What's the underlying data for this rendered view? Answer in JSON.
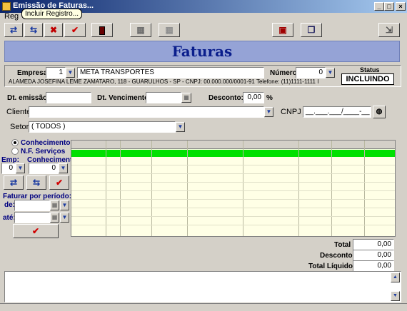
{
  "window": {
    "title": "Emissão de Faturas..."
  },
  "menu": {
    "first": "Reg"
  },
  "tooltip": "Incluir Registro...",
  "toolbar": {
    "add_icon": "add-record-icon",
    "edit_icon": "edit-record-icon",
    "delete_icon": "delete-icon",
    "confirm_icon": "check-icon",
    "calculator_icon": "calculator-icon",
    "print_icon": "printer-icon",
    "preview_icon": "grid-icon",
    "search_icon": "search-doc-icon",
    "copy_icon": "copy-doc-icon",
    "exit_icon": "exit-icon"
  },
  "banner": {
    "title": "Faturas"
  },
  "company": {
    "empresa_label": "Empresa",
    "empresa_value": "1",
    "empresa_name": "META TRANSPORTES",
    "numero_label": "Número",
    "numero_value": "0",
    "status_label": "Status",
    "status_value": "INCLUINDO",
    "address": "ALAMEDA JOSEFINA LEME ZAMATARO, 118 - GUARULHOS - SP - CNPJ: 00.000.000/0001-91 Telefone: (11)1111-1111 I"
  },
  "dates": {
    "emissao_label": "Dt. emissão:",
    "vencimento_label": "Dt. Vencimento:",
    "desconto_label": "Desconto:",
    "desconto_value": "0,00",
    "pct": "%"
  },
  "cliente": {
    "label": "Cliente",
    "value": "",
    "cnpj_label": "CNPJ",
    "cnpj_mask": "__.___.___/____-__"
  },
  "setor": {
    "label": "Setor",
    "value": "( TODOS )"
  },
  "left_panel": {
    "radio_conhecimento": "Conhecimento",
    "radio_nf": "N.F. Serviços",
    "emp_label": "Emp:",
    "emp_value": "0",
    "conh_label": "Conhecimento:",
    "conh_value": "0",
    "periodo_label": "Faturar por período:",
    "de_label": "de:",
    "ate_label": "até:"
  },
  "totals": {
    "total_label": "Total",
    "total_value": "0,00",
    "desconto_label": "Desconto",
    "desconto_value": "0,00",
    "liquido_label": "Total Líquido",
    "liquido_value": "0,00"
  },
  "colors": {
    "banner_bg": "#95a3d6",
    "banner_text": "#0a1e8c",
    "selected_row": "#00e000",
    "grid_bg": "#ffffe6"
  }
}
